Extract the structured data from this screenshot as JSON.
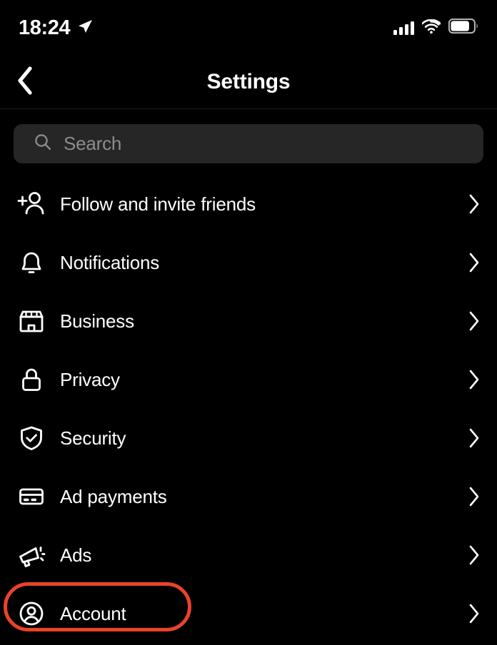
{
  "status_bar": {
    "time": "18:24",
    "location_icon": "location-arrow-icon",
    "signal_icon": "cellular-signal-icon",
    "wifi_icon": "wifi-icon",
    "battery_icon": "battery-icon",
    "battery_level_pct": 75
  },
  "header": {
    "back_icon": "chevron-left-icon",
    "title": "Settings"
  },
  "search": {
    "icon": "search-icon",
    "placeholder": "Search",
    "value": ""
  },
  "colors": {
    "background": "#000000",
    "search_field": "#262626",
    "text_primary": "#ffffff",
    "text_placeholder": "#8d8d8d",
    "separator": "#1c1c1c",
    "annotation_highlight": "#ea432a"
  },
  "settings_list": {
    "items": [
      {
        "label": "Follow and invite friends",
        "icon": "person-add-icon",
        "chevron": "chevron-right-icon",
        "highlighted": false
      },
      {
        "label": "Notifications",
        "icon": "bell-icon",
        "chevron": "chevron-right-icon",
        "highlighted": false
      },
      {
        "label": "Business",
        "icon": "storefront-icon",
        "chevron": "chevron-right-icon",
        "highlighted": false
      },
      {
        "label": "Privacy",
        "icon": "lock-icon",
        "chevron": "chevron-right-icon",
        "highlighted": false
      },
      {
        "label": "Security",
        "icon": "shield-check-icon",
        "chevron": "chevron-right-icon",
        "highlighted": false
      },
      {
        "label": "Ad payments",
        "icon": "credit-card-icon",
        "chevron": "chevron-right-icon",
        "highlighted": false
      },
      {
        "label": "Ads",
        "icon": "megaphone-icon",
        "chevron": "chevron-right-icon",
        "highlighted": false
      },
      {
        "label": "Account",
        "icon": "account-circle-icon",
        "chevron": "chevron-right-icon",
        "highlighted": true
      }
    ]
  }
}
